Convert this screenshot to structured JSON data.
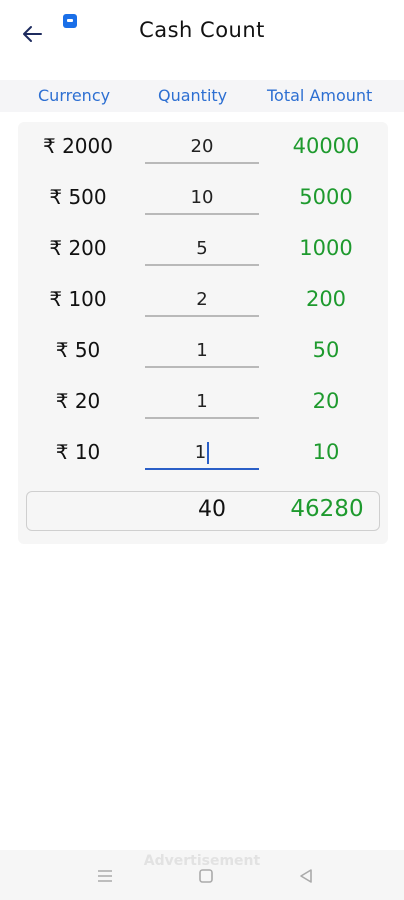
{
  "header": {
    "title": "Cash Count",
    "back_icon": "arrow-left-icon",
    "notification_icon": "notification-badge-icon"
  },
  "columns": {
    "currency": "Currency",
    "quantity": "Quantity",
    "total": "Total Amount"
  },
  "rows": [
    {
      "currency": "₹ 2000",
      "quantity": "20",
      "amount": "40000"
    },
    {
      "currency": "₹ 500",
      "quantity": "10",
      "amount": "5000"
    },
    {
      "currency": "₹ 200",
      "quantity": "5",
      "amount": "1000"
    },
    {
      "currency": "₹ 100",
      "quantity": "2",
      "amount": "200"
    },
    {
      "currency": "₹ 50",
      "quantity": "1",
      "amount": "50"
    },
    {
      "currency": "₹ 20",
      "quantity": "1",
      "amount": "20"
    },
    {
      "currency": "₹ 10",
      "quantity": "1",
      "amount": "10"
    }
  ],
  "totals": {
    "quantity": "40",
    "amount": "46280"
  },
  "ad": {
    "label": "Advertisement"
  },
  "colors": {
    "accent": "#2d6fd2",
    "amount": "#1e9a2e"
  },
  "system_nav": {
    "icons": [
      "menu-icon",
      "home-icon",
      "back-triangle-icon"
    ]
  }
}
